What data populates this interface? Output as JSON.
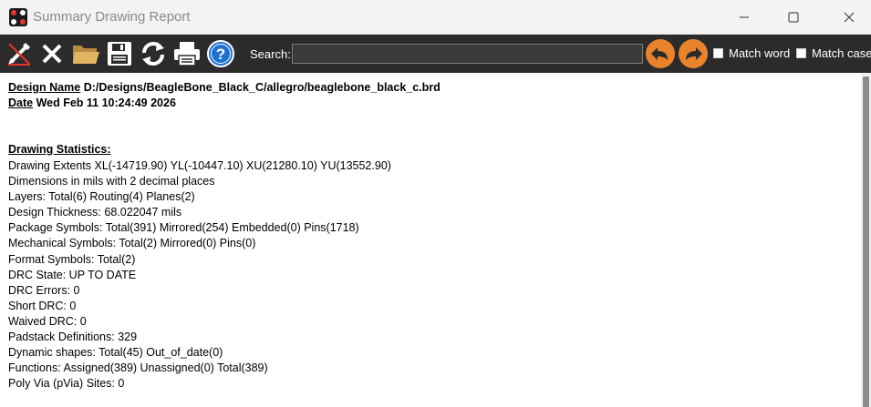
{
  "window": {
    "title": "Summary Drawing Report"
  },
  "toolbar": {
    "search_label": "Search:",
    "search_value": "",
    "match_word_label": "Match word",
    "match_case_label": "Match case",
    "match_word_checked": false,
    "match_case_checked": false,
    "accent_color": "#e8832c",
    "icons": [
      "edit-pencil-icon",
      "close-x-icon",
      "open-folder-icon",
      "save-disk-icon",
      "refresh-icon",
      "print-icon",
      "help-icon",
      "search-previous-icon",
      "search-next-icon"
    ]
  },
  "report": {
    "design_name_label": "Design Name",
    "design_name_value": "D:/Designs/BeagleBone_Black_C/allegro/beaglebone_black_c.brd",
    "date_label": "Date",
    "date_value": "Wed Feb 11 10:24:49 2026",
    "stats_title": "Drawing Statistics:",
    "lines": [
      "Drawing Extents XL(-14719.90) YL(-10447.10) XU(21280.10) YU(13552.90)",
      "Dimensions in mils with 2 decimal places",
      "Layers: Total(6) Routing(4) Planes(2)",
      "Design Thickness: 68.022047 mils",
      "Package Symbols: Total(391) Mirrored(254) Embedded(0) Pins(1718)",
      "Mechanical Symbols: Total(2) Mirrored(0) Pins(0)",
      "Format Symbols: Total(2)",
      "DRC State: UP TO DATE",
      "DRC Errors: 0",
      "Short DRC: 0",
      "Waived DRC: 0",
      "Padstack Definitions: 329",
      "Dynamic shapes: Total(45) Out_of_date(0)",
      "Functions: Assigned(389) Unassigned(0) Total(389)",
      "Poly Via (pVia) Sites: 0"
    ]
  }
}
